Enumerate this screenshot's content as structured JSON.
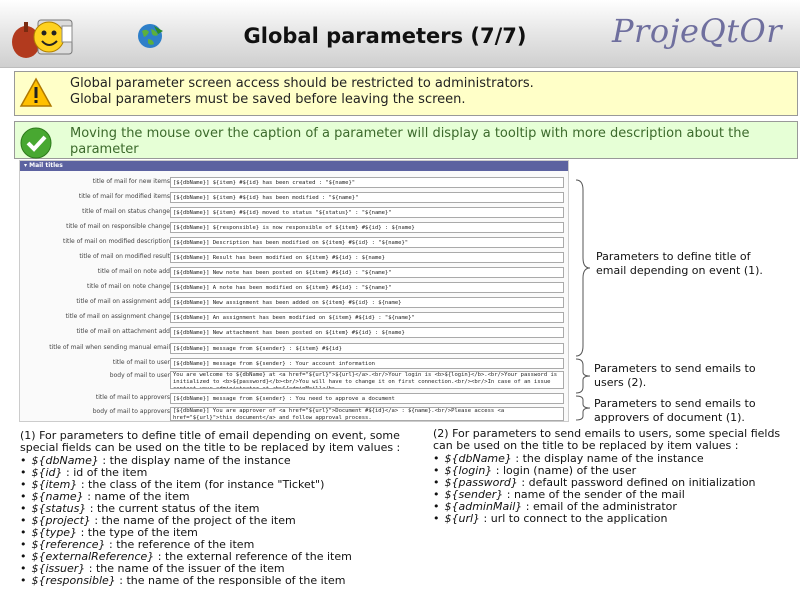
{
  "header": {
    "title": "Global parameters (7/7)",
    "brand": "ProjeQtOr"
  },
  "notes": {
    "warning_lines": [
      "Global parameter screen access should be restricted to administrators.",
      "Global parameters must be saved before leaving the screen."
    ],
    "info_lines": [
      "Moving the mouse over the caption of a parameter will display a tooltip with more description about the",
      "parameter"
    ]
  },
  "form": {
    "section_title": "▾ Mail titles",
    "rows": [
      {
        "label": "title of mail for new items",
        "value": "[${dbName}] ${item} #${id} has been created : \"${name}\""
      },
      {
        "label": "title of mail for modified items",
        "value": "[${dbName}] ${item} #${id} has been modified : \"${name}\""
      },
      {
        "label": "title of mail on status change",
        "value": "[${dbName}] ${item} #${id} moved to status \"${status}\" : \"${name}\""
      },
      {
        "label": "title of mail on responsible change",
        "value": "[${dbName}] ${responsible} is now responsible of ${item} #${id} : ${name}"
      },
      {
        "label": "title of mail on modified description",
        "value": "[${dbName}] Description has been modified on ${item} #${id} : \"${name}\""
      },
      {
        "label": "title of mail on modified result",
        "value": "[${dbName}] Result has been modified on ${item} #${id} : ${name}"
      },
      {
        "label": "title of mail on note add",
        "value": "[${dbName}] New note has been posted on ${item} #${id} : \"${name}\""
      },
      {
        "label": "title of mail on note change",
        "value": "[${dbName}] A note has been modified on ${item} #${id} : \"${name}\""
      },
      {
        "label": "title of mail on assignment add",
        "value": "[${dbName}] New assignment has been added on ${item} #${id} : ${name}"
      },
      {
        "label": "title of mail on assignment change",
        "value": "[${dbName}] An assignment has been modified on ${item} #${id} : \"${name}\""
      },
      {
        "label": "title of mail on attachment add",
        "value": "[${dbName}] New attachment has been posted on ${item} #${id} : ${name}"
      },
      {
        "label": "title of mail when sending manual email",
        "value": "[${dbName}] message from ${sender} : ${item} #${id}"
      },
      {
        "label": "title of mail to user",
        "value": "[${dbName}] message from ${sender} : Your account information"
      },
      {
        "label": "body of mail to user",
        "value": "You are welcome to ${dbName} at <a href=\"${url}\">${url}</a>.<br/>Your login is <b>${login}</b>.<br/>Your password is initialized to <b>${password}</b><br/>You will have to change it on first connection.<br/><br/>In case of an issue contact your administrator at <b>${adminMail}</b>."
      },
      {
        "label": "title of mail to approvers",
        "value": "[${dbName}] message from ${sender} : You need to approve a document"
      },
      {
        "label": "body of mail to approvers",
        "value": "[${dbName}] You are approver of <a href=\"${url}\">Document #${id}</a> : ${name}.<br/>Please access <a href=\"${url}\">this document</a> and follow approval process."
      }
    ]
  },
  "annotations": {
    "titles": [
      "Parameters to define title of",
      "email depending on event (1)."
    ],
    "users": [
      "Parameters to send emails to",
      "users (2)."
    ],
    "approvers": [
      "Parameters to send emails to",
      "approvers of document (1)."
    ]
  },
  "left_list": {
    "intro": [
      "(1) For parameters to define title of email depending on event, some",
      "special fields can be used on the title to be replaced by item values :"
    ],
    "items": [
      {
        "term": "${dbName}",
        "desc": " : the display name of the instance"
      },
      {
        "term": "${id}",
        "desc": " : id of the item"
      },
      {
        "term": "${item}",
        "desc": " : the class of the item (for instance \"Ticket\")"
      },
      {
        "term": "${name}",
        "desc": " : name of the item"
      },
      {
        "term": "${status}",
        "desc": " : the current status of the item"
      },
      {
        "term": "${project}",
        "desc": " : the name of the project of the item"
      },
      {
        "term": "${type}",
        "desc": " : the type of the item"
      },
      {
        "term": "${reference}",
        "desc": " : the reference of the item"
      },
      {
        "term": "${externalReference}",
        "desc": " : the external reference of the item"
      },
      {
        "term": "${issuer}",
        "desc": " : the name of the issuer of the item"
      },
      {
        "term": "${responsible}",
        "desc": "  : the name of the responsible of the item"
      }
    ]
  },
  "right_list": {
    "intro": [
      "(2) For parameters to send emails to users, some special fields",
      "can be used on the title to be replaced by item values :"
    ],
    "items": [
      {
        "term": "${dbName}",
        "desc": " : the display name of the instance"
      },
      {
        "term": "${login}",
        "desc": " : login (name) of the user"
      },
      {
        "term": "${password}",
        "desc": " : default password defined on initialization"
      },
      {
        "term": "${sender}",
        "desc": " : name of the sender of the mail"
      },
      {
        "term": "${adminMail}",
        "desc": " : email of the administrator"
      },
      {
        "term": "${url}",
        "desc": " : url to connect to the application"
      }
    ]
  }
}
